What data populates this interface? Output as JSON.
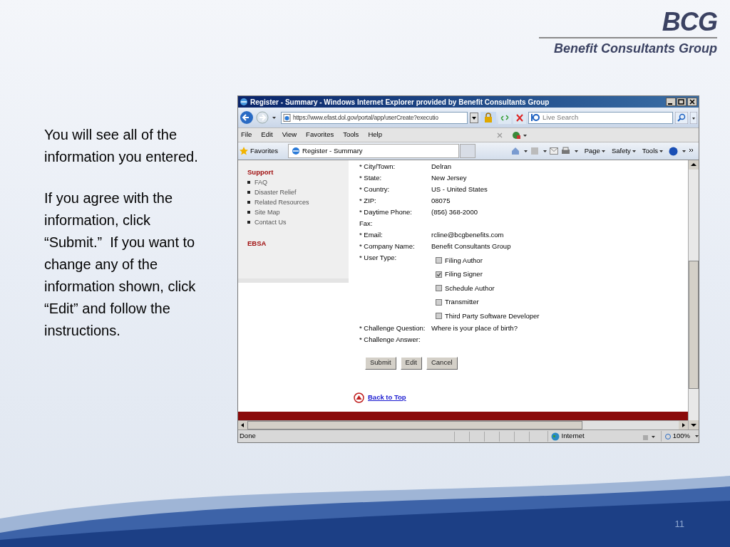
{
  "logo": {
    "mark": "BCG",
    "name": "Benefit Consultants Group"
  },
  "instructions": [
    "You will see all of the information you entered.",
    "If you agree with the information, click “Submit.”  If you want to change any of the information shown, click “Edit” and follow the instructions."
  ],
  "browser": {
    "title": "Register - Summary - Windows Internet Explorer provided by Benefit Consultants Group",
    "address": "https://www.efast.dol.gov/portal/app/userCreate?executio",
    "search_placeholder": "Live Search",
    "menu": [
      "File",
      "Edit",
      "View",
      "Favorites",
      "Tools",
      "Help"
    ],
    "favorites": "Favorites",
    "tab": "Register - Summary",
    "commands": [
      "Page",
      "Safety",
      "Tools"
    ],
    "sidebar": [
      {
        "title": "Support",
        "items": [
          "FAQ",
          "Disaster Relief",
          "Related Resources",
          "Site Map",
          "Contact Us"
        ]
      },
      {
        "title": "EBSA"
      }
    ],
    "fields": [
      {
        "label": "* City/Town:",
        "value": "Delran"
      },
      {
        "label": "* State:",
        "value": "New Jersey"
      },
      {
        "label": "* Country:",
        "value": "US - United States"
      },
      {
        "label": "* ZIP:",
        "value": "08075"
      },
      {
        "label": "* Daytime Phone:",
        "value": "(856) 368-2000"
      },
      {
        "label": "Fax:"
      },
      {
        "label": "* Email:",
        "value": "rcline@bcgbenefits.com"
      },
      {
        "label": "* Company Name:",
        "value": "Benefit Consultants Group"
      }
    ],
    "user_type_label": "* User Type:",
    "user_types": [
      {
        "label": "Filing Author",
        "checked": false
      },
      {
        "label": "Filing Signer",
        "checked": true
      },
      {
        "label": "Schedule Author",
        "checked": false
      },
      {
        "label": "Transmitter",
        "checked": false
      },
      {
        "label": "Third Party Software Developer",
        "checked": false
      }
    ],
    "challenge": [
      {
        "label": "* Challenge Question:",
        "value": "Where is your place of birth?"
      },
      {
        "label": "* Challenge Answer:"
      }
    ],
    "buttons": [
      "Submit",
      "Edit",
      "Cancel"
    ],
    "back_to_top": "Back to Top",
    "status": "Done",
    "zone": "Internet",
    "zoom": "100%"
  },
  "page_number": "11"
}
